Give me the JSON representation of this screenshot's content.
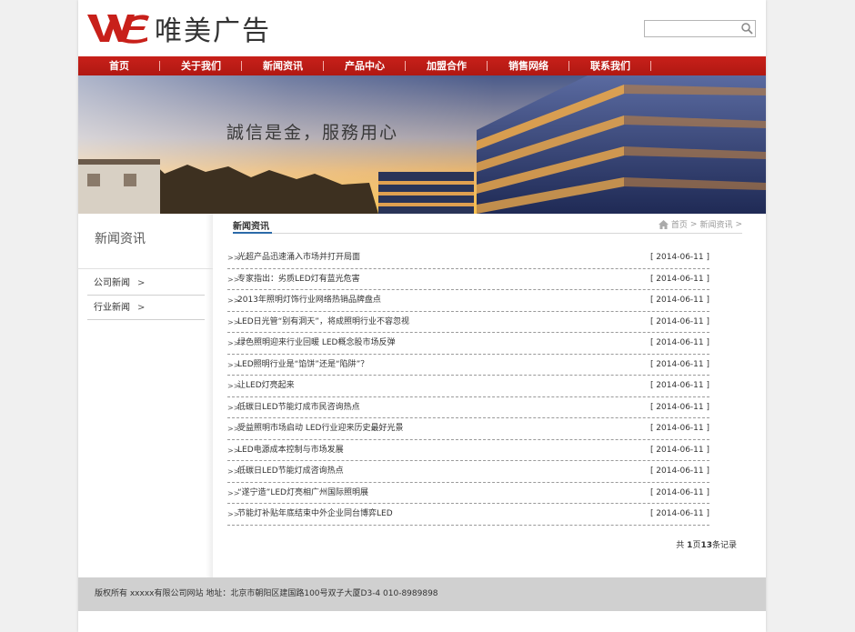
{
  "brand": {
    "name": "唯美广告",
    "logo_icon": "we-logo-icon",
    "accent_color": "#c8201a"
  },
  "search": {
    "placeholder": "",
    "icon": "search-icon"
  },
  "nav": [
    {
      "label": "首页"
    },
    {
      "label": "关于我们"
    },
    {
      "label": "新闻资讯"
    },
    {
      "label": "产品中心"
    },
    {
      "label": "加盟合作"
    },
    {
      "label": "销售网络"
    },
    {
      "label": "联系我们"
    }
  ],
  "banner": {
    "slogan": "誠信是金，服務用心"
  },
  "sidebar": {
    "title": "新闻资讯",
    "items": [
      {
        "label": "公司新闻",
        "arrow": ">"
      },
      {
        "label": "行业新闻",
        "arrow": ">"
      }
    ]
  },
  "main": {
    "title": "新闻资讯",
    "breadcrumb": {
      "icon": "home-icon",
      "home": "首页",
      "sep": ">",
      "current": "新闻资讯",
      "tail": ">"
    },
    "bullet": ">>",
    "news": [
      {
        "title": "光超产品迅速涌入市场并打开局面",
        "date": "[ 2014-06-11 ]"
      },
      {
        "title": "专家指出：劣质LED灯有蓝光危害",
        "date": "[ 2014-06-11 ]"
      },
      {
        "title": "2013年照明灯饰行业网络热销品牌盘点",
        "date": "[ 2014-06-11 ]"
      },
      {
        "title": "LED日光管“别有洞天”，将成照明行业不容忽视",
        "date": "[ 2014-06-11 ]"
      },
      {
        "title": "绿色照明迎来行业回暖 LED概念股市场反弹",
        "date": "[ 2014-06-11 ]"
      },
      {
        "title": "LED照明行业是“馅饼”还是“陷阱”？",
        "date": "[ 2014-06-11 ]"
      },
      {
        "title": "让LED灯亮起来",
        "date": "[ 2014-06-11 ]"
      },
      {
        "title": "低碳日LED节能灯成市民咨询热点",
        "date": "[ 2014-06-11 ]"
      },
      {
        "title": "受益照明市场启动 LED行业迎来历史最好光景",
        "date": "[ 2014-06-11 ]"
      },
      {
        "title": "LED电源成本控制与市场发展",
        "date": "[ 2014-06-11 ]"
      },
      {
        "title": "低碳日LED节能灯成咨询热点",
        "date": "[ 2014-06-11 ]"
      },
      {
        "title": "“遂宁造”LED灯亮相广州国际照明展",
        "date": "[ 2014-06-11 ]"
      },
      {
        "title": "节能灯补贴年底结束中外企业同台博弈LED",
        "date": "[ 2014-06-11 ]"
      }
    ],
    "pager": {
      "prefix": "共",
      "pages": "1",
      "pages_label": "页",
      "count": "13",
      "count_label": "条记录"
    }
  },
  "footer": {
    "text": "版权所有 xxxxx有限公司网站 地址：北京市朝阳区建国路100号双子大厦D3-4 010-8989898"
  }
}
